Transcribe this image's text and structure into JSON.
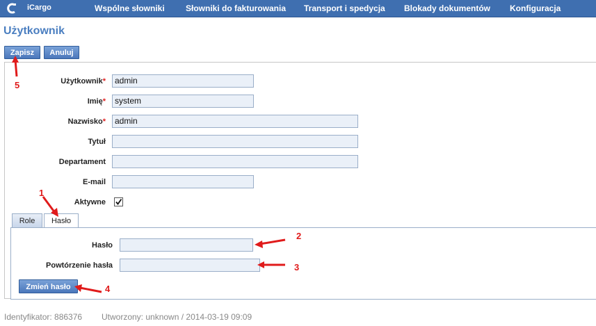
{
  "app": {
    "name": "iCargo"
  },
  "nav": {
    "items": [
      {
        "label": "Wspólne słowniki"
      },
      {
        "label": "Słowniki do fakturowania"
      },
      {
        "label": "Transport i spedycja"
      },
      {
        "label": "Blokady dokumentów"
      },
      {
        "label": "Konfiguracja"
      }
    ]
  },
  "page": {
    "title": "Użytkownik"
  },
  "toolbar": {
    "save_label": "Zapisz",
    "cancel_label": "Anuluj"
  },
  "form": {
    "fields": [
      {
        "label": "Użytkownik",
        "required": "*",
        "value": "admin"
      },
      {
        "label": "Imię",
        "required": "*",
        "value": "system"
      },
      {
        "label": "Nazwisko",
        "required": "*",
        "value": "admin"
      },
      {
        "label": "Tytuł",
        "required": "",
        "value": ""
      },
      {
        "label": "Departament",
        "required": "",
        "value": ""
      },
      {
        "label": "E-mail",
        "required": "",
        "value": ""
      }
    ],
    "active": {
      "label": "Aktywne",
      "checked": true
    }
  },
  "tabs": [
    {
      "label": "Role"
    },
    {
      "label": "Hasło"
    }
  ],
  "password": {
    "password_label": "Hasło",
    "repeat_label": "Powtórzenie hasła",
    "change_button": "Zmień hasło"
  },
  "footer": {
    "id_text": "Identyfikator: 886376",
    "created_text": "Utworzony: unknown / 2014-03-19 09:09"
  },
  "annotations": [
    "1",
    "2",
    "3",
    "4",
    "5"
  ],
  "colors": {
    "nav_bg": "#3f6fb0",
    "title": "#4a7ec0",
    "annotation": "#e01b1b",
    "input_bg": "#eaf0f8"
  }
}
